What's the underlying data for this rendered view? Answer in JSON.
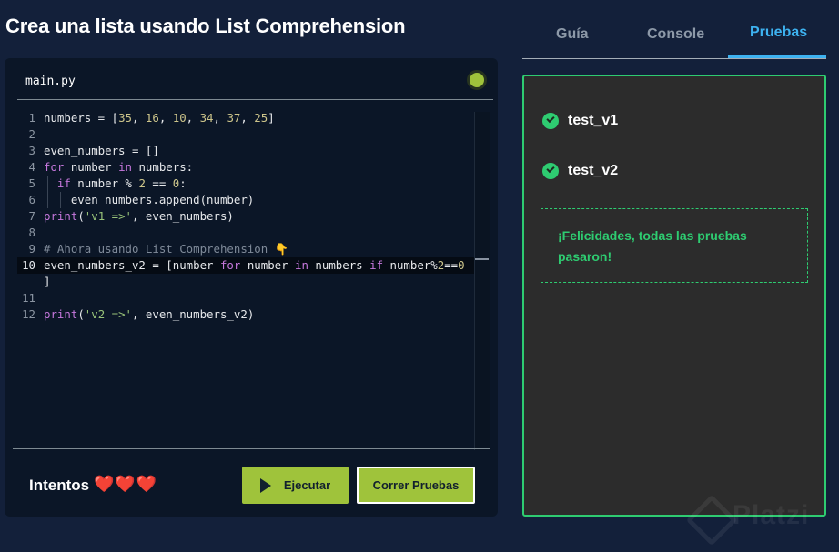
{
  "page": {
    "title": "Crea una lista usando List Comprehension"
  },
  "editor": {
    "file_tab": "main.py",
    "status_icon": "status-dot-icon",
    "lines": [
      {
        "n": "1",
        "t": [
          [
            "numbers = [",
            ""
          ],
          [
            "35",
            "num"
          ],
          [
            ", ",
            ""
          ],
          [
            "16",
            "num"
          ],
          [
            ", ",
            ""
          ],
          [
            "10",
            "num"
          ],
          [
            ", ",
            ""
          ],
          [
            "34",
            "num"
          ],
          [
            ", ",
            ""
          ],
          [
            "37",
            "num"
          ],
          [
            ", ",
            ""
          ],
          [
            "25",
            "num"
          ],
          [
            "]",
            ""
          ]
        ]
      },
      {
        "n": "2",
        "t": []
      },
      {
        "n": "3",
        "t": [
          [
            "even_numbers = []",
            ""
          ]
        ]
      },
      {
        "n": "4",
        "t": [
          [
            "for",
            "kw"
          ],
          [
            " number ",
            ""
          ],
          [
            "in",
            "kw"
          ],
          [
            " numbers:",
            ""
          ]
        ]
      },
      {
        "n": "5",
        "t": [
          [
            "  ",
            ""
          ],
          [
            "if",
            "kw"
          ],
          [
            " number % ",
            ""
          ],
          [
            "2",
            "num"
          ],
          [
            " == ",
            ""
          ],
          [
            "0",
            "num"
          ],
          [
            ":",
            ""
          ]
        ]
      },
      {
        "n": "6",
        "t": [
          [
            "    even_numbers.append(number)",
            ""
          ]
        ]
      },
      {
        "n": "7",
        "t": [
          [
            "print",
            "fn"
          ],
          [
            "(",
            ""
          ],
          [
            "'v1 =>'",
            "str"
          ],
          [
            ", even_numbers)",
            ""
          ]
        ]
      },
      {
        "n": "8",
        "t": []
      },
      {
        "n": "9",
        "t": [
          [
            "# Ahora usando List Comprehension 👇",
            "cm"
          ]
        ]
      },
      {
        "n": "10",
        "t": [
          [
            "even_numbers_v2 = [number ",
            ""
          ],
          [
            "for",
            "kw"
          ],
          [
            " number ",
            ""
          ],
          [
            "in",
            "kw"
          ],
          [
            " numbers ",
            ""
          ],
          [
            "if",
            "kw"
          ],
          [
            " number%",
            ""
          ],
          [
            "2",
            "num"
          ],
          [
            "==",
            ""
          ],
          [
            "0",
            "num"
          ]
        ]
      },
      {
        "n": "",
        "t": [
          [
            "]",
            ""
          ]
        ]
      },
      {
        "n": "11",
        "t": []
      },
      {
        "n": "12",
        "t": [
          [
            "print",
            "fn"
          ],
          [
            "(",
            ""
          ],
          [
            "'v2 =>'",
            "str"
          ],
          [
            ", even_numbers_v2)",
            ""
          ]
        ]
      }
    ],
    "attempts_label": "Intentos",
    "hearts": "❤️❤️❤️",
    "run_label": "Ejecutar",
    "tests_label": "Correr Pruebas"
  },
  "panel": {
    "tabs": [
      {
        "label": "Guía"
      },
      {
        "label": "Console"
      },
      {
        "label": "Pruebas"
      }
    ],
    "active_tab": "Pruebas",
    "tests": [
      {
        "name": "test_v1",
        "status": "passed"
      },
      {
        "name": "test_v2",
        "status": "passed"
      }
    ],
    "success_message": "¡Felicidades, todas las pruebas pasaron!"
  },
  "colors": {
    "accent_green": "#9fc33b",
    "success_green": "#2ecc71",
    "tab_active_blue": "#3db2f0",
    "background": "#13203a"
  },
  "watermark": "Platzi"
}
